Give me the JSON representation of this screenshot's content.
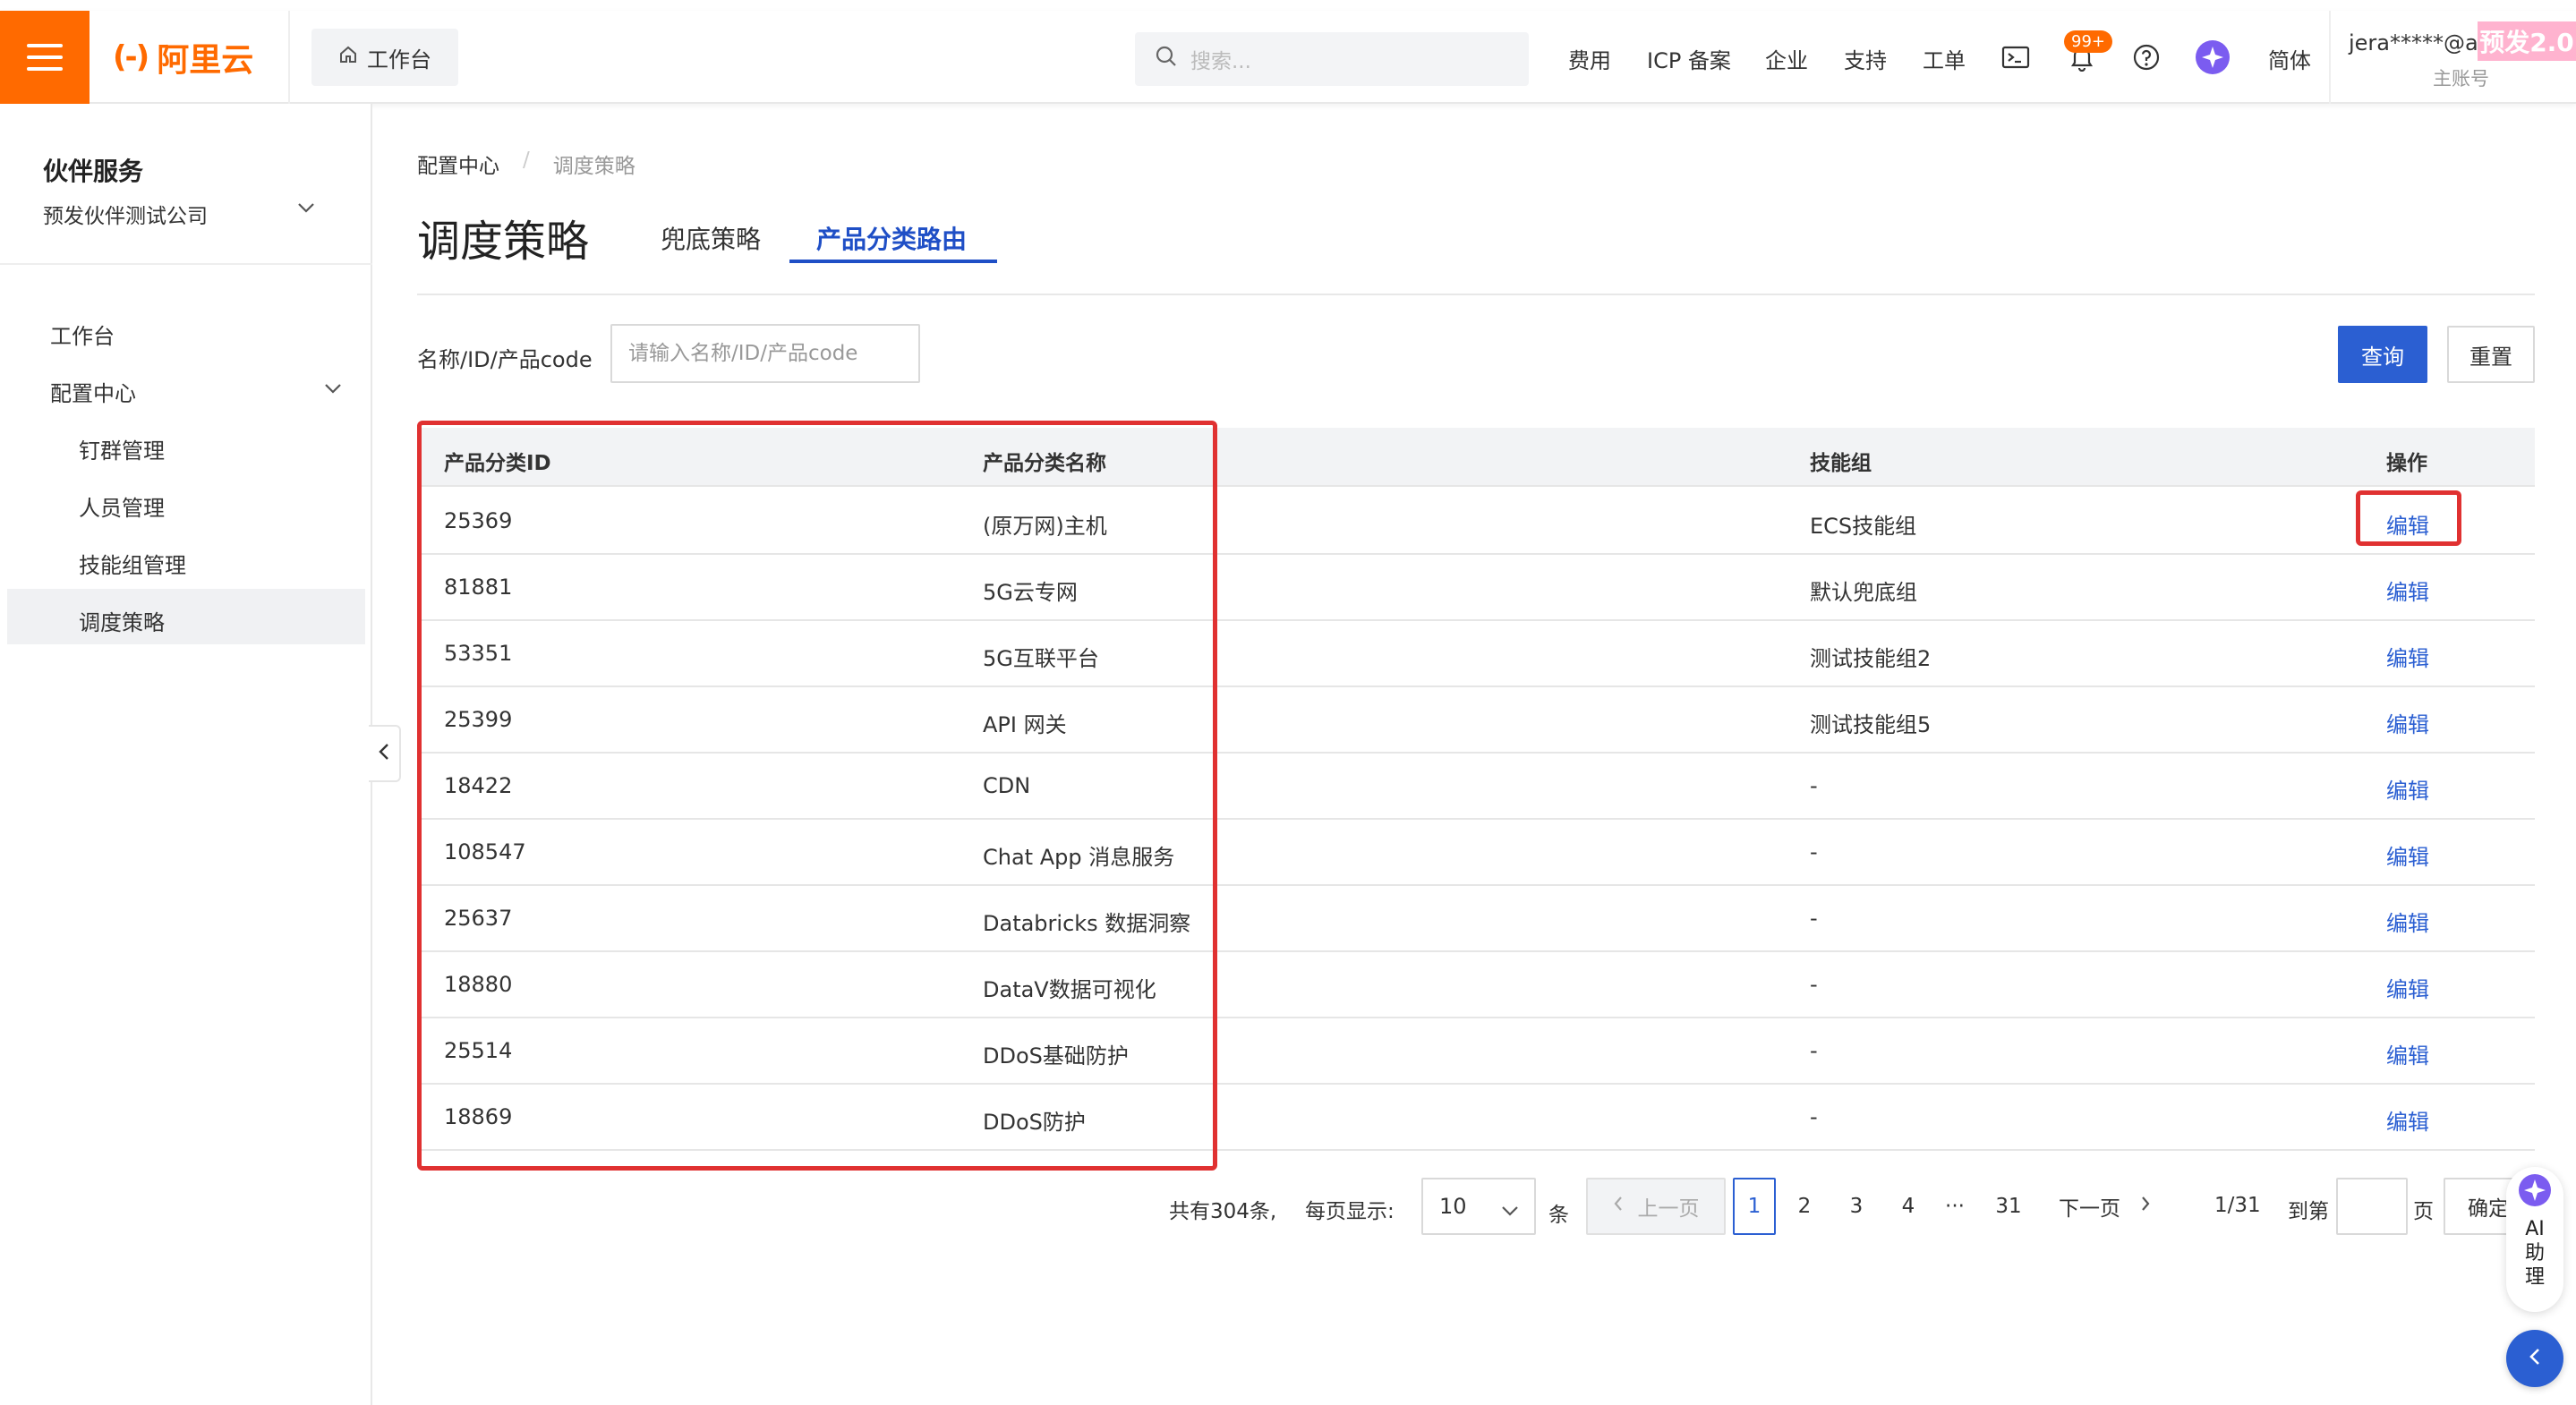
{
  "topbar": {
    "logo_text": "阿里云",
    "logo_mark": "(-)",
    "workbench_label": "工作台",
    "search_placeholder": "搜索...",
    "nav": [
      "费用",
      "ICP 备案",
      "企业",
      "支持",
      "工单"
    ],
    "notification_badge": "99+",
    "language": "简体",
    "account_name": "jera*****@al...",
    "account_role": "主账号",
    "env_tag": "预发2.0",
    "colors": {
      "brand": "#ff6a00",
      "primary": "#2b5fd2"
    }
  },
  "sidebar": {
    "title": "伙伴服务",
    "company": "预发伙伴测试公司",
    "items": [
      {
        "label": "工作台"
      },
      {
        "label": "配置中心"
      },
      {
        "label": "钉群管理"
      },
      {
        "label": "人员管理"
      },
      {
        "label": "技能组管理"
      },
      {
        "label": "调度策略"
      }
    ]
  },
  "breadcrumb": {
    "parent": "配置中心",
    "separator": "/",
    "current": "调度策略"
  },
  "page": {
    "title": "调度策略",
    "tabs": [
      {
        "label": "兜底策略"
      },
      {
        "label": "产品分类路由"
      }
    ]
  },
  "filter": {
    "label": "名称/ID/产品code",
    "placeholder": "请输入名称/ID/产品code",
    "query_label": "查询",
    "reset_label": "重置"
  },
  "table": {
    "headers": [
      "产品分类ID",
      "产品分类名称",
      "技能组",
      "操作"
    ],
    "rows": [
      {
        "id": "25369",
        "name": "(原万网)主机",
        "group": "ECS技能组",
        "action": "编辑"
      },
      {
        "id": "81881",
        "name": "5G云专网",
        "group": "默认兜底组",
        "action": "编辑"
      },
      {
        "id": "53351",
        "name": "5G互联平台",
        "group": "测试技能组2",
        "action": "编辑"
      },
      {
        "id": "25399",
        "name": "API 网关",
        "group": "测试技能组5",
        "action": "编辑"
      },
      {
        "id": "18422",
        "name": "CDN",
        "group": "-",
        "action": "编辑"
      },
      {
        "id": "108547",
        "name": "Chat App 消息服务",
        "group": "-",
        "action": "编辑"
      },
      {
        "id": "25637",
        "name": "Databricks 数据洞察",
        "group": "-",
        "action": "编辑"
      },
      {
        "id": "18880",
        "name": "DataV数据可视化",
        "group": "-",
        "action": "编辑"
      },
      {
        "id": "25514",
        "name": "DDoS基础防护",
        "group": "-",
        "action": "编辑"
      },
      {
        "id": "18869",
        "name": "DDoS防护",
        "group": "-",
        "action": "编辑"
      }
    ]
  },
  "pagination": {
    "total_text": "共有304条,",
    "per_page_label": "每页显示:",
    "page_size": "10",
    "unit": "条",
    "prev_label": "上一页",
    "pages": [
      "1",
      "2",
      "3",
      "4",
      "···",
      "31"
    ],
    "next_label": "下一页",
    "page_indicator": "1/31",
    "goto_label": "到第",
    "page_unit": "页",
    "confirm_label": "确定"
  },
  "ai_assistant": {
    "label": "AI助理"
  }
}
